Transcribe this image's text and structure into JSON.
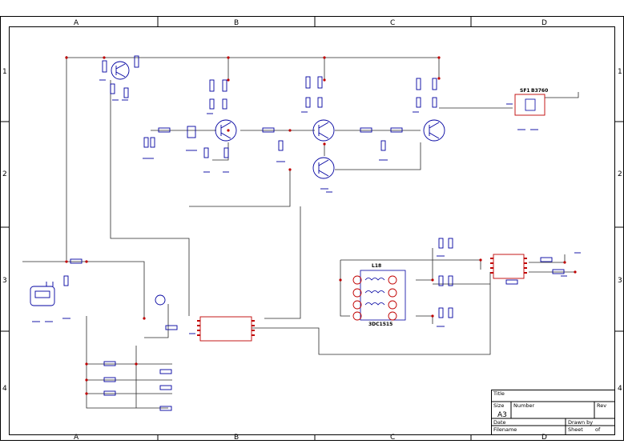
{
  "border": {
    "columns": [
      "A",
      "B",
      "C",
      "D"
    ],
    "rows": [
      "1",
      "2",
      "3",
      "4"
    ]
  },
  "title_block": {
    "title_label": "Title",
    "size_label": "Size",
    "size_value": "A3",
    "number_label": "Number",
    "rev_label": "Rev",
    "date_label": "Date",
    "filename_label": "Filename",
    "drawn_by_label": "Drawn by",
    "sheet_label": "Sheet",
    "of_label": "of"
  },
  "components": {
    "filter_ref": "SF1",
    "filter_part": "B3760",
    "transformer_ref": "L18",
    "transformer_part": "3DC1515"
  },
  "colors": {
    "wire": "#2a2a2a",
    "component": "#0000a0",
    "pin": "#c00000",
    "border": "#000000"
  }
}
